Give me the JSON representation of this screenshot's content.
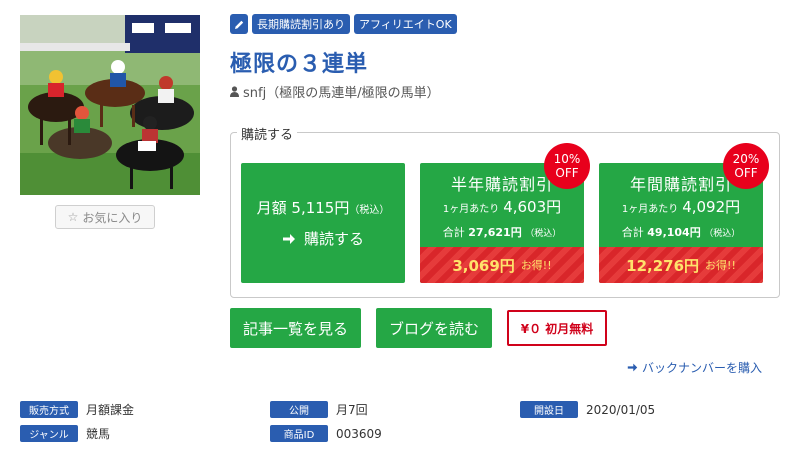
{
  "tags": [
    "長期購読割引あり",
    "アフィリエイトOK"
  ],
  "title": "極限の３連単",
  "author": "snfj（極限の馬連単/極限の馬単）",
  "favorite_label": "お気に入り",
  "subscribe": {
    "legend": "購読する",
    "monthly": {
      "price": "月額 5,115円",
      "tax": "（税込）",
      "cta": "購読する"
    },
    "half_year": {
      "name": "半年購読割引",
      "per_label": "1ヶ月あたり",
      "per_price": "4,603円",
      "total_label": "合計",
      "total_price": "27,621円",
      "tax": "（税込）",
      "save_amount": "3,069円",
      "save_label": "お得!!",
      "badge_pct": "10%",
      "badge_off": "OFF"
    },
    "year": {
      "name": "年間購読割引",
      "per_label": "1ヶ月あたり",
      "per_price": "4,092円",
      "total_label": "合計",
      "total_price": "49,104円",
      "tax": "（税込）",
      "save_amount": "12,276円",
      "save_label": "お得!!",
      "badge_pct": "20%",
      "badge_off": "OFF"
    }
  },
  "buttons": {
    "articles": "記事一覧を見る",
    "blog": "ブログを読む",
    "free": "¥０ 初月無料"
  },
  "backnumber": "バックナンバーを購入",
  "info": {
    "sales_method_label": "販売方式",
    "sales_method": "月額課金",
    "publish_label": "公開",
    "publish": "月7回",
    "start_label": "開設日",
    "start": "2020/01/05",
    "genre_label": "ジャンル",
    "genre": "競馬",
    "product_id_label": "商品ID",
    "product_id": "003609"
  },
  "colors": {
    "green": "#25a745",
    "blue": "#2a5db0",
    "red": "#d9262a",
    "badge": "#e8001c",
    "gold": "#ffe36b"
  },
  "icons": [
    "pencil-icon",
    "user-icon",
    "star-icon",
    "arrow-right-icon"
  ]
}
